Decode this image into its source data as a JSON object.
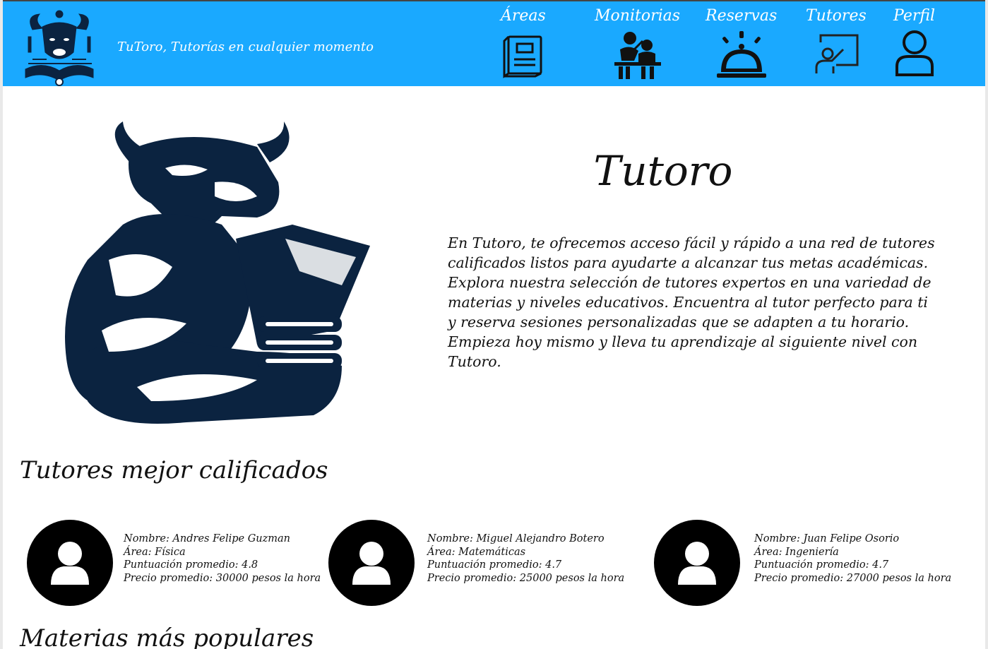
{
  "header": {
    "tagline": "TuToro, Tutorías en cualquier momento",
    "nav": [
      {
        "label": "Áreas",
        "icon": "book-icon"
      },
      {
        "label": "Monitorias",
        "icon": "tutoring-session-icon"
      },
      {
        "label": "Reservas",
        "icon": "service-bell-icon"
      },
      {
        "label": "Tutores",
        "icon": "teacher-board-icon"
      },
      {
        "label": "Perfil",
        "icon": "user-profile-icon"
      }
    ]
  },
  "hero": {
    "title": "Tutoro",
    "description": "En Tutoro, te ofrecemos acceso fácil y rápido a una red de tutores calificados listos para ayudarte a alcanzar tus metas académicas. Explora nuestra selección de tutores expertos en una variedad de materias y niveles educativos. Encuentra al tutor perfecto para ti y reserva sesiones  personalizadas que se adapten a tu horario. Empieza hoy mismo y lleva tu  aprendizaje al siguiente nivel con Tutoro."
  },
  "top_tutors": {
    "title": "Tutores mejor calificados",
    "tutors": [
      {
        "name": "Nombre: Andres Felipe Guzman",
        "area": "Área: Física",
        "rating": "Puntuación promedio: 4.8",
        "price": "Precio promedio: 30000 pesos la hora"
      },
      {
        "name": "Nombre: Miguel Alejandro Botero",
        "area": "Área: Matemáticas",
        "rating": "Puntuación promedio: 4.7",
        "price": "Precio promedio: 25000 pesos la hora"
      },
      {
        "name": "Nombre: Juan Felipe Osorio",
        "area": "Área: Ingeniería",
        "rating": "Puntuación promedio: 4.7",
        "price": "Precio promedio: 27000 pesos la hora"
      }
    ]
  },
  "popular_subjects": {
    "title": "Materias más populares"
  },
  "colors": {
    "header_bg": "#1aa9ff",
    "logo_navy": "#0b2340",
    "text": "#111111"
  }
}
